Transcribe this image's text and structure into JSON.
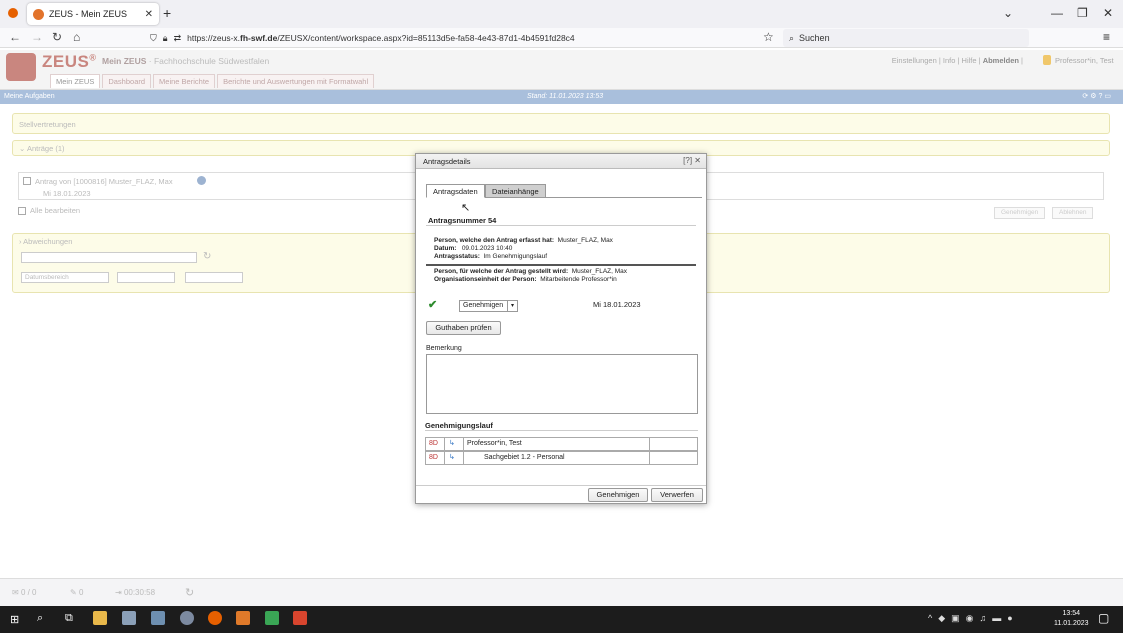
{
  "browser": {
    "tab_title": "ZEUS - Mein ZEUS",
    "url_prefix": "https://zeus-x.",
    "url_domain": "fh-swf.de",
    "url_rest": "/ZEUSX/content/workspace.aspx?id=85113d5e-fa58-4e43-87d1-4b4591fd28c4",
    "search_placeholder": "Suchen"
  },
  "app": {
    "logo_text": "ZEUS",
    "logo_reg": "®",
    "title": "Mein ZEUS",
    "org": "Fachhochschule Südwestfalen",
    "links": [
      "Einstellungen",
      "Info",
      "Hilfe"
    ],
    "logout": "Abmelden",
    "user": "Professor*in, Test",
    "tabs": [
      "Mein ZEUS",
      "Dashboard",
      "Meine Berichte",
      "Berichte und Auswertungen mit Formatwahl"
    ],
    "bar_title": "Meine Aufgaben",
    "stand": "Stand: 11.01.2023 13:53"
  },
  "panels": {
    "stellvertretungen": "Stellvertretungen",
    "antraege": "Anträge (1)",
    "antrag_row": "Antrag von [1000816] Muster_FLAZ, Max",
    "antrag_date": "Mi 18.01.2023",
    "alle": "Alle bearbeiten",
    "genehmigen": "Genehmigen",
    "ablehnen": "Ablehnen",
    "abweichungen": "Abweichungen",
    "datumsbereich": "Datumsbereich"
  },
  "dialog": {
    "title": "Antragsdetails",
    "tabs": [
      "Antragsdaten",
      "Dateianhänge"
    ],
    "nummer": "Antragsnummer 54",
    "erfasst_label": "Person, welche den Antrag erfasst hat:",
    "erfasst_val": "Muster_FLAZ, Max",
    "datum_label": "Datum:",
    "datum_val": "09.01.2023 10:40",
    "status_label": "Antragsstatus:",
    "status_val": "Im Genehmigungslauf",
    "fuer_label": "Person, für welche der Antrag gestellt wird:",
    "fuer_val": "Muster_FLAZ, Max",
    "org_label": "Organisationseinheit der Person:",
    "org_val": "Mitarbeitende Professor*in",
    "select_val": "Genehmigen",
    "date": "Mi 18.01.2023",
    "guthaben": "Guthaben prüfen",
    "bemerkung": "Bemerkung",
    "lauf": "Genehmigungslauf",
    "lauf_rows": [
      "Professor*in, Test",
      "Sachgebiet 1.2 - Personal"
    ],
    "btn_ok": "Genehmigen",
    "btn_no": "Verwerfen"
  },
  "bottom": {
    "msgs": "0 / 0",
    "edits": "0",
    "timer": "00:30:58"
  },
  "taskbar": {
    "time": "13:54",
    "date": "11.01.2023"
  }
}
